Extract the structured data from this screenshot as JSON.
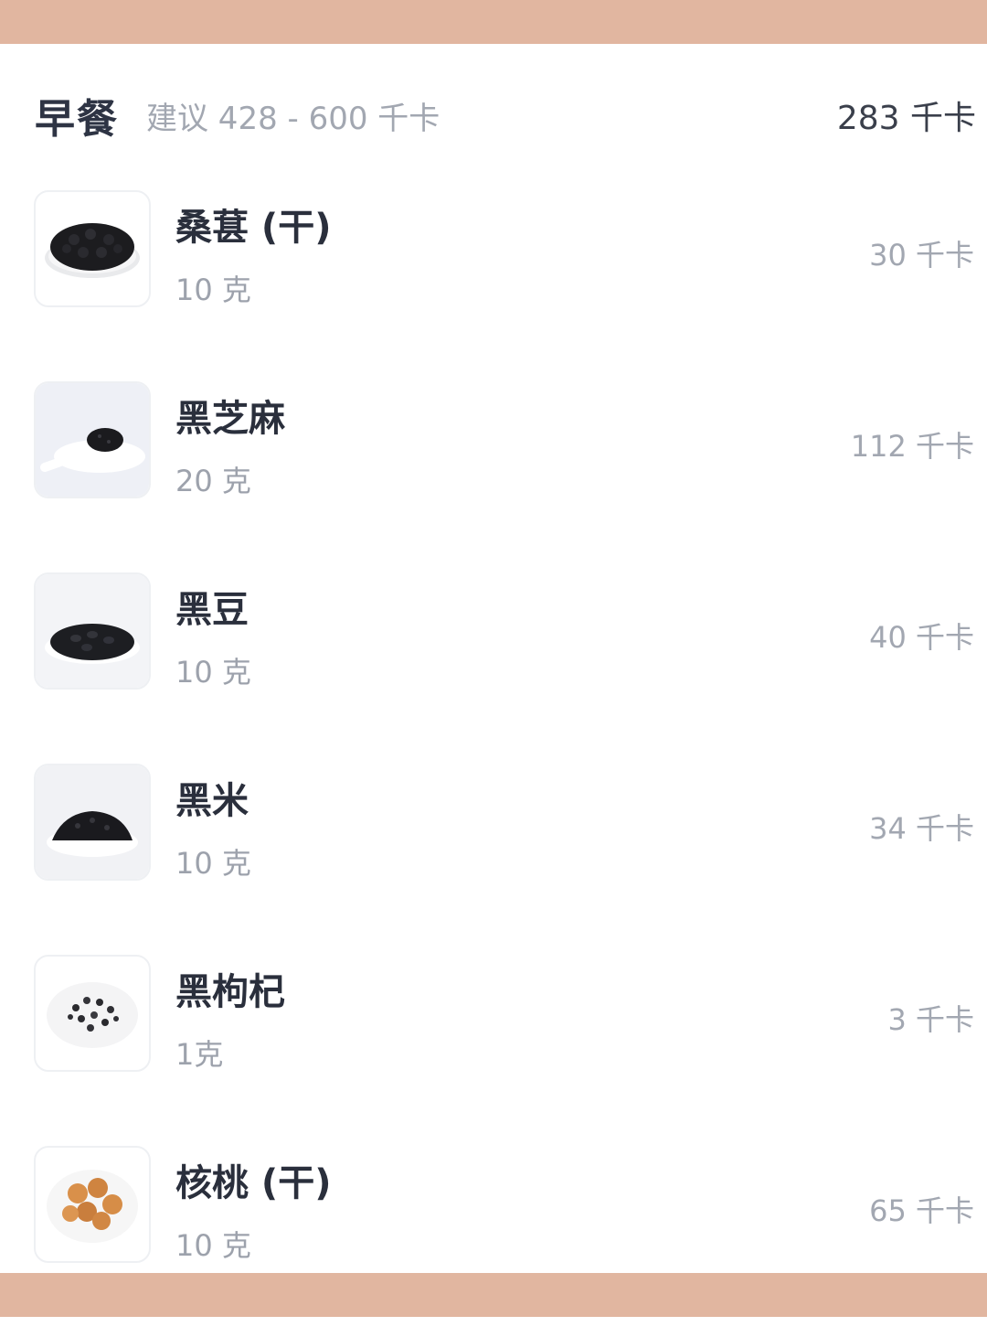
{
  "meal": {
    "title": "早餐",
    "suggestion": "建议 428 - 600 千卡",
    "total": "283 千卡"
  },
  "items": [
    {
      "name": "桑葚 (干)",
      "amount": "10 克",
      "kcal": "30 千卡",
      "icon": "mulberry-icon"
    },
    {
      "name": "黑芝麻",
      "amount": "20 克",
      "kcal": "112 千卡",
      "icon": "black-sesame-icon"
    },
    {
      "name": "黑豆",
      "amount": "10 克",
      "kcal": "40 千卡",
      "icon": "black-bean-icon"
    },
    {
      "name": "黑米",
      "amount": "10 克",
      "kcal": "34 千卡",
      "icon": "black-rice-icon"
    },
    {
      "name": "黑枸杞",
      "amount": "1克",
      "kcal": "3 千卡",
      "icon": "black-goji-icon"
    },
    {
      "name": "核桃 (干)",
      "amount": "10 克",
      "kcal": "65 千卡",
      "icon": "walnut-icon"
    }
  ],
  "colors": {
    "band": "#e1b6a0",
    "title": "#2e3444",
    "muted": "#a2a7b1"
  }
}
